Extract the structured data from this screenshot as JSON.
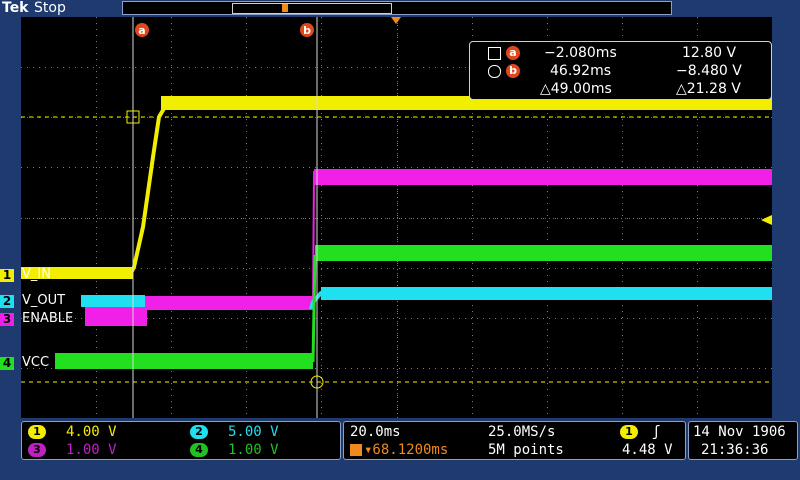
{
  "header": {
    "brand": "Tek",
    "status": "Stop"
  },
  "cursor_markers": {
    "a": "a",
    "b": "b"
  },
  "cursor_readout": {
    "a_time": "−2.080ms",
    "a_value": "12.80 V",
    "b_time": "46.92ms",
    "b_value": "−8.480 V",
    "delta_time": "△49.00ms",
    "delta_value": "△21.28 V"
  },
  "channels": [
    {
      "num": "1",
      "name": "V_IN",
      "color": "#f2ee00",
      "scale": "4.00 V"
    },
    {
      "num": "2",
      "name": "V_OUT",
      "color": "#1fe0f0",
      "scale": "5.00 V"
    },
    {
      "num": "3",
      "name": "ENABLE",
      "color": "#f020e8",
      "scale": "1.00 V"
    },
    {
      "num": "4",
      "name": "VCC",
      "color": "#22e020",
      "scale": "1.00 V"
    }
  ],
  "timebase": {
    "time_div": "20.0ms",
    "sample_rate": "25.0MS/s",
    "trigger_pos": "▾68.1200ms",
    "record_length": "5M points"
  },
  "trigger": {
    "source": "1",
    "slope": "ʃ",
    "level": "4.48 V"
  },
  "datetime": {
    "date": "14 Nov 1906",
    "time": "21:36:36"
  },
  "colors": {
    "background": "#1f3a6e",
    "grid": "#7a7a7a",
    "cursor": "#e0481c",
    "trigger_marker": "#f08a1c"
  }
}
